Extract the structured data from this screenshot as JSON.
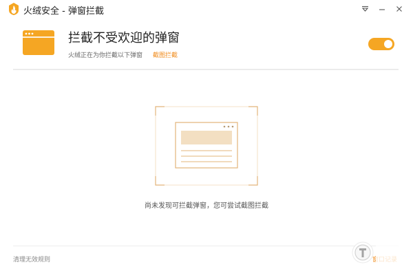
{
  "window": {
    "title": "火绒安全 - 弹窗拦截",
    "icons": {
      "logo": "huorong-flame-logo",
      "menu": "menu-icon",
      "minimize": "minimize-icon",
      "close": "close-icon"
    }
  },
  "header": {
    "title": "拦截不受欢迎的弹窗",
    "subtitle": "火绒正在为你拦截以下弹窗",
    "link": "截图拦截",
    "toggle_on": true,
    "icon": "popup-window-icon"
  },
  "empty_state": {
    "message": "尚未发现可拦截弹窗，您可尝试截图拦截",
    "icon": "empty-popup-illustration"
  },
  "footer": {
    "left_link": "清理无效规则",
    "right_link": "窗口记录"
  },
  "colors": {
    "accent": "#f5a623",
    "link": "#f08c1e",
    "divider": "#ebebeb"
  }
}
